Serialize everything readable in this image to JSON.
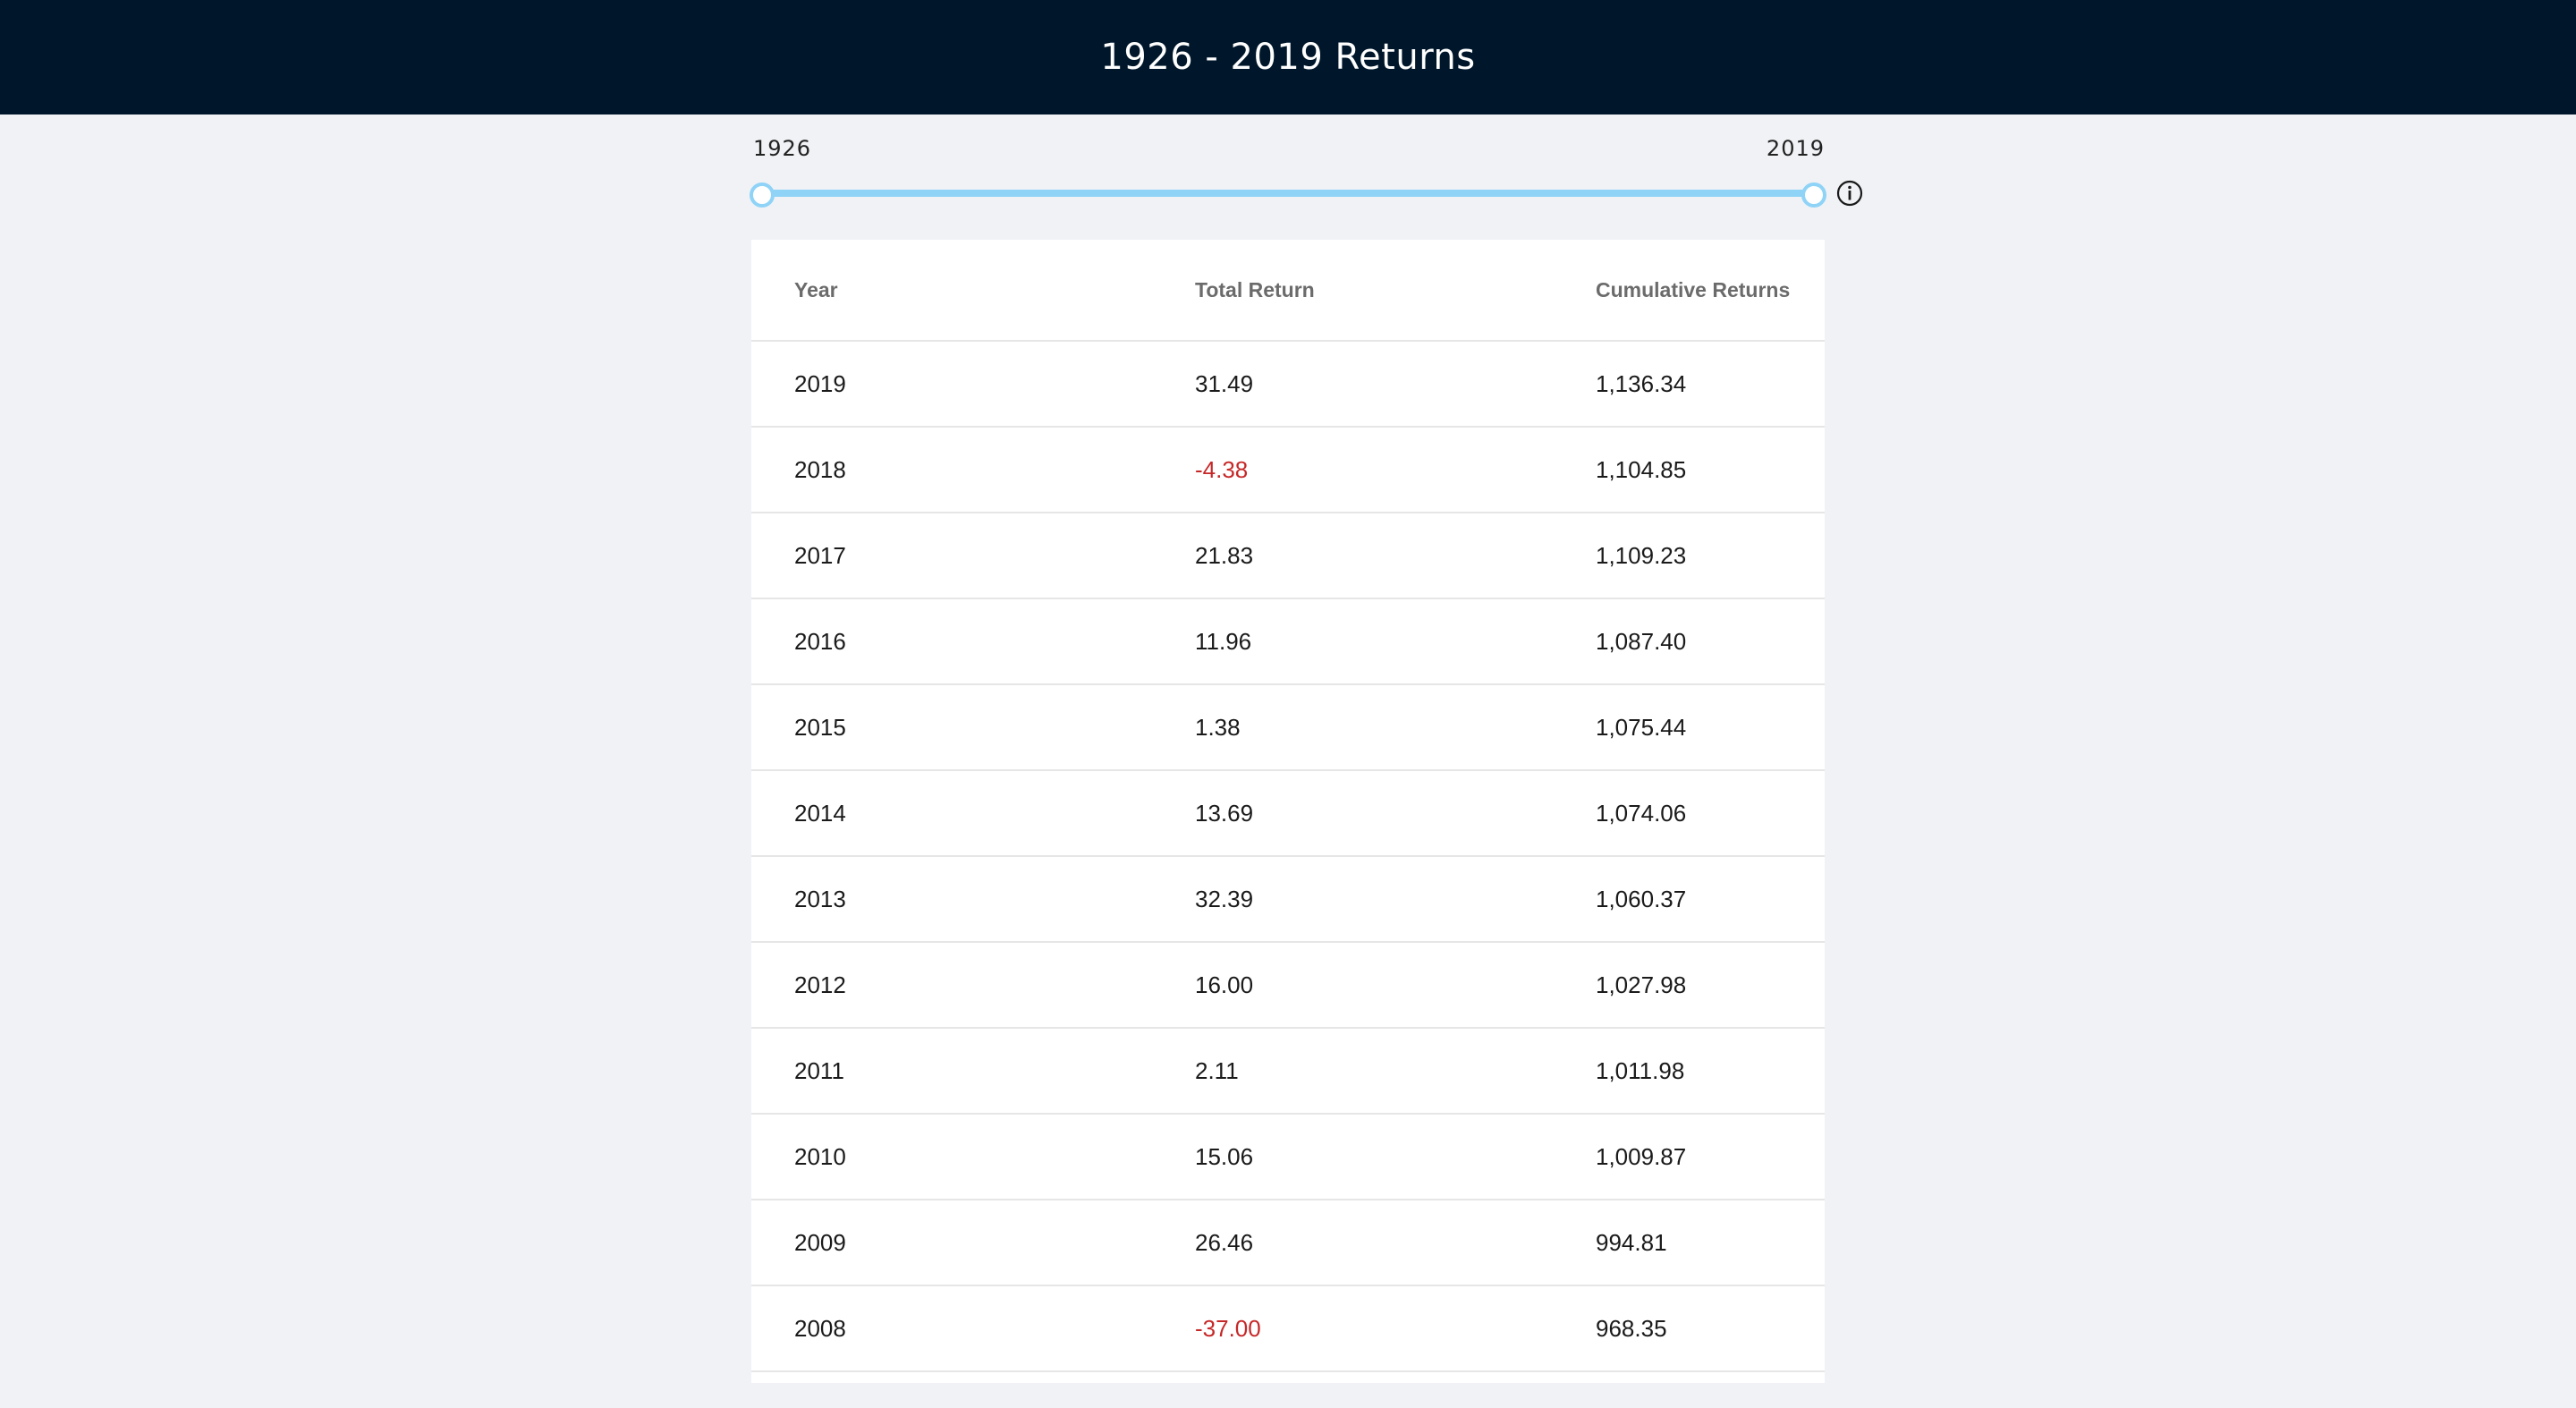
{
  "header": {
    "title": "1926 - 2019 Returns"
  },
  "slider": {
    "start_label": "1926",
    "end_label": "2019",
    "min": 1926,
    "max": 2019,
    "selected_start": 1926,
    "selected_end": 2019,
    "track_color": "#8fd3f7"
  },
  "info_icon": "info-icon",
  "table": {
    "headers": [
      "Year",
      "Total Return",
      "Cumulative Returns"
    ],
    "negative_color": "#c62828",
    "rows": [
      {
        "year": "2019",
        "total_return": "31.49",
        "cumulative": "1,136.34"
      },
      {
        "year": "2018",
        "total_return": "-4.38",
        "cumulative": "1,104.85"
      },
      {
        "year": "2017",
        "total_return": "21.83",
        "cumulative": "1,109.23"
      },
      {
        "year": "2016",
        "total_return": "11.96",
        "cumulative": "1,087.40"
      },
      {
        "year": "2015",
        "total_return": "1.38",
        "cumulative": "1,075.44"
      },
      {
        "year": "2014",
        "total_return": "13.69",
        "cumulative": "1,074.06"
      },
      {
        "year": "2013",
        "total_return": "32.39",
        "cumulative": "1,060.37"
      },
      {
        "year": "2012",
        "total_return": "16.00",
        "cumulative": "1,027.98"
      },
      {
        "year": "2011",
        "total_return": "2.11",
        "cumulative": "1,011.98"
      },
      {
        "year": "2010",
        "total_return": "15.06",
        "cumulative": "1,009.87"
      },
      {
        "year": "2009",
        "total_return": "26.46",
        "cumulative": "994.81"
      },
      {
        "year": "2008",
        "total_return": "-37.00",
        "cumulative": "968.35"
      }
    ]
  }
}
